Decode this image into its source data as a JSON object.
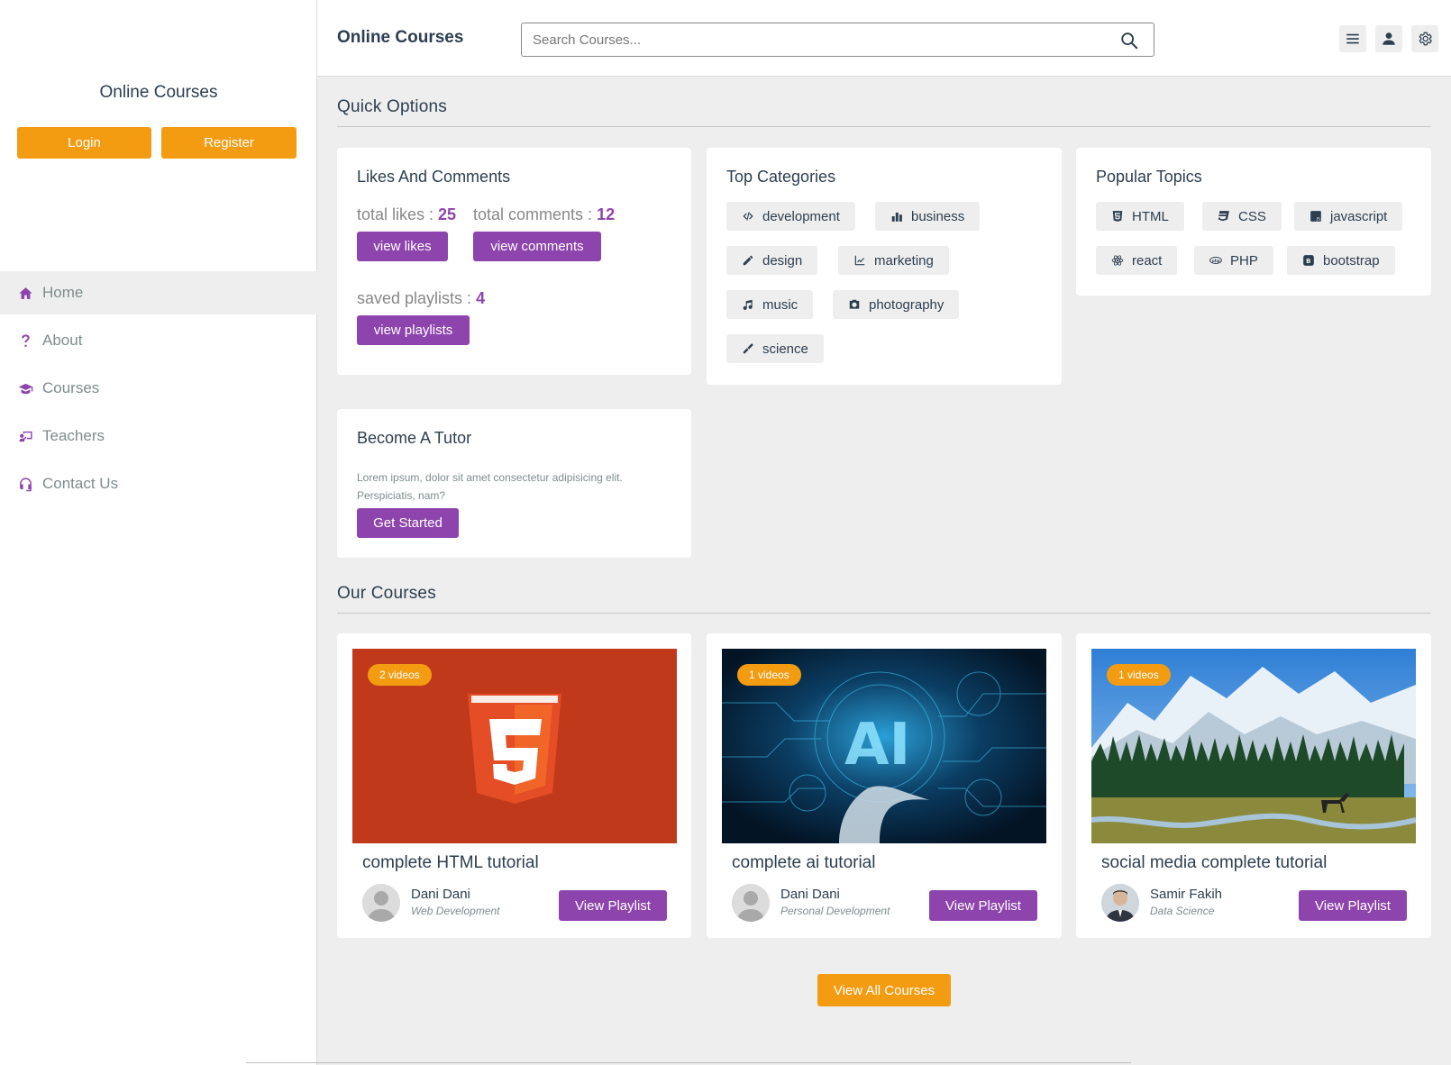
{
  "app": {
    "title": "Online Courses"
  },
  "header": {
    "logo": "Online Courses",
    "search_placeholder": "Search Courses...",
    "icons": [
      "menu-icon",
      "user-icon",
      "gear-icon"
    ]
  },
  "sidebar": {
    "title": "Online Courses",
    "login_label": "Login",
    "register_label": "Register",
    "items": [
      {
        "label": "Home",
        "icon": "home-icon",
        "active": true
      },
      {
        "label": "About",
        "icon": "question-icon"
      },
      {
        "label": "Courses",
        "icon": "graduation-cap-icon"
      },
      {
        "label": "Teachers",
        "icon": "chalkboard-teacher-icon"
      },
      {
        "label": "Contact Us",
        "icon": "headset-icon"
      }
    ]
  },
  "quick_options": {
    "title": "Quick Options",
    "likes": {
      "title": "Likes And Comments",
      "likes_label": "total likes : ",
      "likes_value": "25",
      "comments_label": "total comments : ",
      "comments_value": "12",
      "view_likes": "view likes",
      "view_comments": "view comments",
      "playlists_label": "saved playlists : ",
      "playlists_value": "4",
      "view_playlists": "view playlists"
    },
    "categories": {
      "title": "Top Categories",
      "items": [
        {
          "label": "development",
          "icon": "code-icon"
        },
        {
          "label": "business",
          "icon": "chart-bar-icon"
        },
        {
          "label": "design",
          "icon": "pen-icon"
        },
        {
          "label": "marketing",
          "icon": "chart-line-icon"
        },
        {
          "label": "music",
          "icon": "music-icon"
        },
        {
          "label": "photography",
          "icon": "camera-icon"
        },
        {
          "label": "science",
          "icon": "cog-icon"
        }
      ]
    },
    "topics": {
      "title": "Popular Topics",
      "items": [
        {
          "label": "HTML",
          "icon": "html5-icon"
        },
        {
          "label": "CSS",
          "icon": "css3-icon"
        },
        {
          "label": "javascript",
          "icon": "js-icon"
        },
        {
          "label": "react",
          "icon": "react-icon"
        },
        {
          "label": "PHP",
          "icon": "php-icon"
        },
        {
          "label": "bootstrap",
          "icon": "bootstrap-icon"
        }
      ]
    },
    "tutor": {
      "title": "Become A Tutor",
      "text": "Lorem ipsum, dolor sit amet consectetur adipisicing elit. Perspiciatis, nam?",
      "button": "Get Started"
    }
  },
  "courses": {
    "title": "Our Courses",
    "items": [
      {
        "badge": "2 videos",
        "title": "complete HTML tutorial",
        "tutor": "Dani Dani",
        "category": "Web Development",
        "button": "View Playlist"
      },
      {
        "badge": "1 videos",
        "title": "complete ai tutorial",
        "tutor": "Dani Dani",
        "category": "Personal Development",
        "button": "View Playlist"
      },
      {
        "badge": "1 videos",
        "title": "social media complete tutorial",
        "tutor": "Samir Fakih",
        "category": "Data Science",
        "button": "View Playlist"
      }
    ],
    "view_all": "View All Courses"
  },
  "colors": {
    "accent": "#8e44ad",
    "orange": "#f39c12",
    "text": "#2c3e50",
    "muted": "#7f8c8d",
    "bg": "#eeeeee"
  }
}
